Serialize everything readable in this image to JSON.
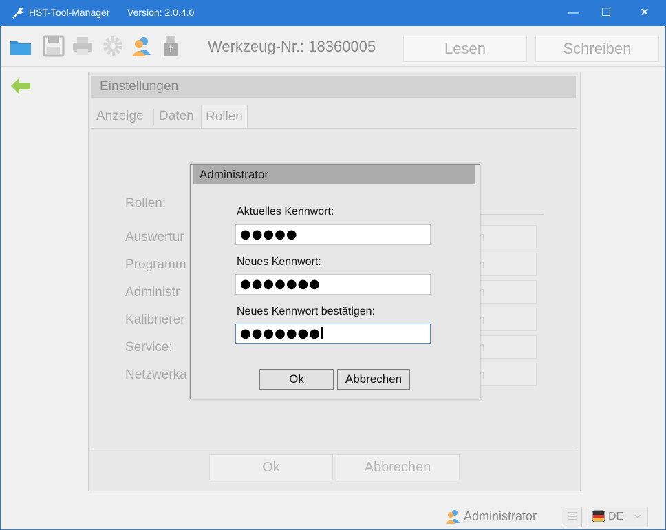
{
  "window": {
    "app_name": "HST-Tool-Manager",
    "version": "Version: 2.0.4.0",
    "controls": {
      "minimize": "—",
      "maximize": "☐",
      "close": "✕"
    }
  },
  "toolbar": {
    "icons": [
      "folder-icon",
      "save-icon",
      "print-icon",
      "gear-icon",
      "user-icon",
      "usb-icon"
    ],
    "tool_number": "Werkzeug-Nr.: 18360005",
    "read_label": "Lesen",
    "write_label": "Schreiben"
  },
  "settings": {
    "title": "Einstellungen",
    "tabs": [
      "Anzeige",
      "Daten",
      "Rollen"
    ],
    "roles_header": "Rollen:",
    "roles": [
      "Auswertur",
      "Programm",
      "Administr",
      "Kalibrierer",
      "Service:",
      "Netzwerka"
    ],
    "role_box_text": "n",
    "ok_label": "Ok",
    "cancel_label": "Abbrechen"
  },
  "dialog": {
    "title": "Administrator",
    "current_label": "Aktuelles Kennwort:",
    "current_value": "●●●●●",
    "new_label": "Neues Kennwort:",
    "new_value": "●●●●●●●",
    "confirm_label": "Neues Kennwort bestätigen:",
    "confirm_value": "●●●●●●●",
    "ok_label": "Ok",
    "cancel_label": "Abbrechen"
  },
  "statusbar": {
    "user": "Administrator",
    "language": "DE"
  },
  "colors": {
    "titlebar": "#2a7ad6",
    "accent": "#4f86d6"
  }
}
